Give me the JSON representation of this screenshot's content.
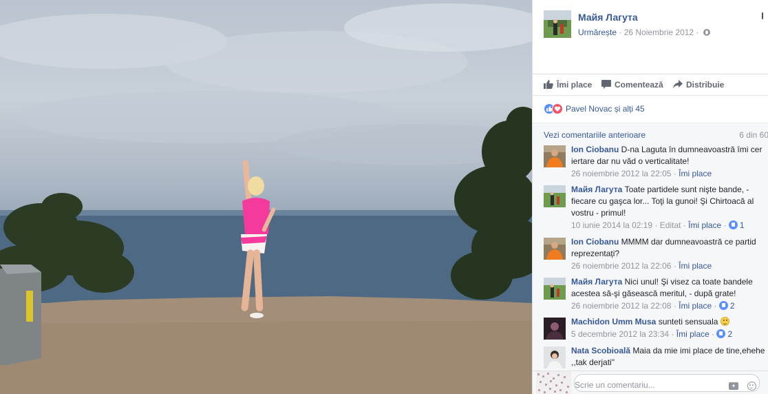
{
  "post": {
    "author": "Майя Лагута",
    "follow_label": "Urmărește",
    "separator": " · ",
    "date": "26 Noiembrie 2012",
    "privacy_icon": "globe-icon"
  },
  "actions": {
    "like_label": "Îmi place",
    "comment_label": "Comentează",
    "share_label": "Distribuie"
  },
  "reactions": {
    "icons": [
      "like-icon",
      "love-icon"
    ],
    "text": "Pavel Novac și alți 45"
  },
  "comments_header": {
    "previous_label": "Vezi comentariile anterioare",
    "count": "6 din 60"
  },
  "comments": [
    {
      "name": "Ion Ciobanu",
      "text": " D-na Laguta în dumneavoastră îmi cer iertare dar nu văd o verticalitate!",
      "time": "26 noiembrie 2012 la 22:05",
      "like_label": "Îmi place",
      "edited": "",
      "likes": ""
    },
    {
      "name": "Майя Лагута",
      "text": " Toate partidele sunt nişte bande, - fiecare cu gaşca lor... Toţi la gunoi! Şi Chirtoacă al vostru - primul!",
      "time": "10 iunie 2014 la 02:19",
      "like_label": "Îmi place",
      "edited": "Editat",
      "likes": "1"
    },
    {
      "name": "Ion Ciobanu",
      "text": " MMMM dar dumneavoastră ce partid reprezentați?",
      "time": "26 noiembrie 2012 la 22:06",
      "like_label": "Îmi place",
      "edited": "",
      "likes": ""
    },
    {
      "name": "Майя Лагута",
      "text": " Nici unul! Şi visez ca toate bandele acestea să-şi găsească meritul, - după grate!",
      "time": "26 noiembrie 2012 la 22:08",
      "like_label": "Îmi place",
      "edited": "",
      "likes": "2"
    },
    {
      "name": "Machidon Umm Musa",
      "text": " sunteti sensuala ",
      "time": "5 decembrie 2012 la 23:34",
      "like_label": "Îmi place",
      "edited": "",
      "likes": "2"
    },
    {
      "name": "Nata Scobioală",
      "text": " Maia da mie imi place de tine,ehehe ,,tak derjati\"",
      "time": "",
      "like_label": "",
      "edited": "",
      "likes": ""
    }
  ],
  "composer": {
    "placeholder": "Scrie un comentariu...",
    "camera_icon": "camera-icon",
    "emoji_icon": "emoji-icon"
  },
  "colors": {
    "link": "#365899",
    "muted": "#90949c",
    "like_blue": "#5890ff",
    "love_red": "#f25268"
  }
}
